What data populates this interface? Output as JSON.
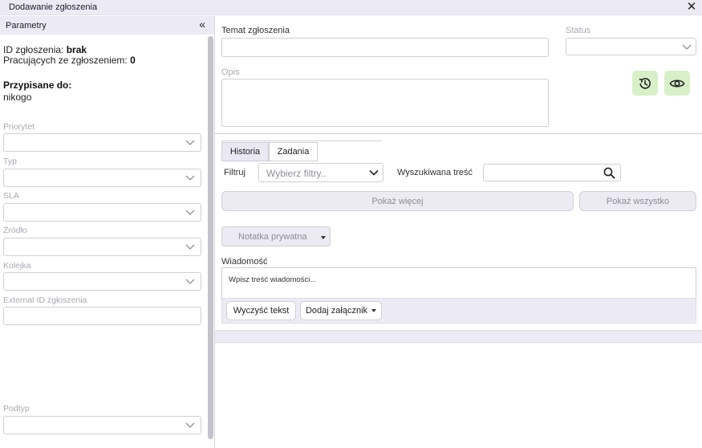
{
  "window": {
    "title": "Dodawanie zgłoszenia",
    "close_icon": "close-icon"
  },
  "sidebar": {
    "header": "Parametry",
    "collapse_icon": "double-chevron-left-icon",
    "id_label": "ID zgłoszenia:",
    "id_value": "brak",
    "working_label": "Pracujących ze zgłoszeniem:",
    "working_value": "0",
    "assigned_label": "Przypisane do:",
    "assigned_value": "nikogo",
    "fields": [
      {
        "label": "Priorytet",
        "value": ""
      },
      {
        "label": "Typ",
        "value": ""
      },
      {
        "label": "SLA",
        "value": ""
      },
      {
        "label": "Źródło",
        "value": ""
      },
      {
        "label": "Kolejka",
        "value": ""
      },
      {
        "label": "External ID zgłoszenia",
        "value": ""
      },
      {
        "label": "Podtyp",
        "value": ""
      }
    ]
  },
  "main": {
    "subject_label": "Temat zgłoszenia",
    "subject_value": "",
    "status_label": "Status",
    "status_value": "",
    "description_label": "Opis",
    "description_value": "",
    "history_icon": "history-icon",
    "preview_icon": "eye-icon",
    "tabs": [
      {
        "label": "Historia",
        "active": true
      },
      {
        "label": "Zadania",
        "active": false
      }
    ],
    "filter_label": "Filtruj",
    "filter_placeholder": "Wybierz filtry..",
    "search_label": "Wyszukiwana treść",
    "search_value": "",
    "search_icon": "search-icon",
    "show_more": "Pokaż więcej",
    "show_all": "Pokaż wszystko",
    "note_type": "Notatka prywatna",
    "message_label": "Wiadomość",
    "message_placeholder": "Wpisz treść wiadomości...",
    "clear_text": "Wyczyść tekst",
    "add_attachment": "Dodaj załącznik"
  },
  "colors": {
    "accent_green": "#d7f0c8",
    "header_bg": "#ecebf5",
    "tab_active_bg": "#e9e8f3"
  }
}
